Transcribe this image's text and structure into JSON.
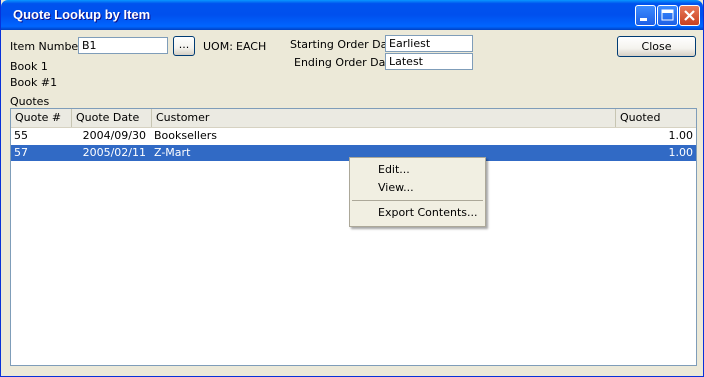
{
  "window": {
    "title": "Quote Lookup by Item"
  },
  "form": {
    "item_number_label": "Item Number:",
    "item_number_value": "B1",
    "browse_label": "...",
    "uom_label": "UOM:",
    "uom_value": "EACH",
    "start_date_label": "Starting Order Date",
    "start_date_value": "Earliest",
    "end_date_label": "Ending Order Date",
    "end_date_value": "Latest",
    "item_desc1": "Book 1",
    "item_desc2": "Book #1",
    "close_label": "Close"
  },
  "quotes": {
    "section_label": "Quotes",
    "columns": [
      "Quote #",
      "Quote Date",
      "Customer",
      "Quoted"
    ],
    "rows": [
      {
        "quote": "55",
        "date": "2004/09/30",
        "customer": "Booksellers",
        "quoted": "1.00"
      },
      {
        "quote": "57",
        "date": "2005/02/11",
        "customer": "Z-Mart",
        "quoted": "1.00"
      }
    ],
    "selected_row": 1
  },
  "context_menu": {
    "items": [
      "Edit...",
      "View...",
      "Export Contents..."
    ]
  },
  "colors": {
    "selection": "#316AC5",
    "title_bar": "#0053EE",
    "window_bg": "#ECE9D8"
  }
}
